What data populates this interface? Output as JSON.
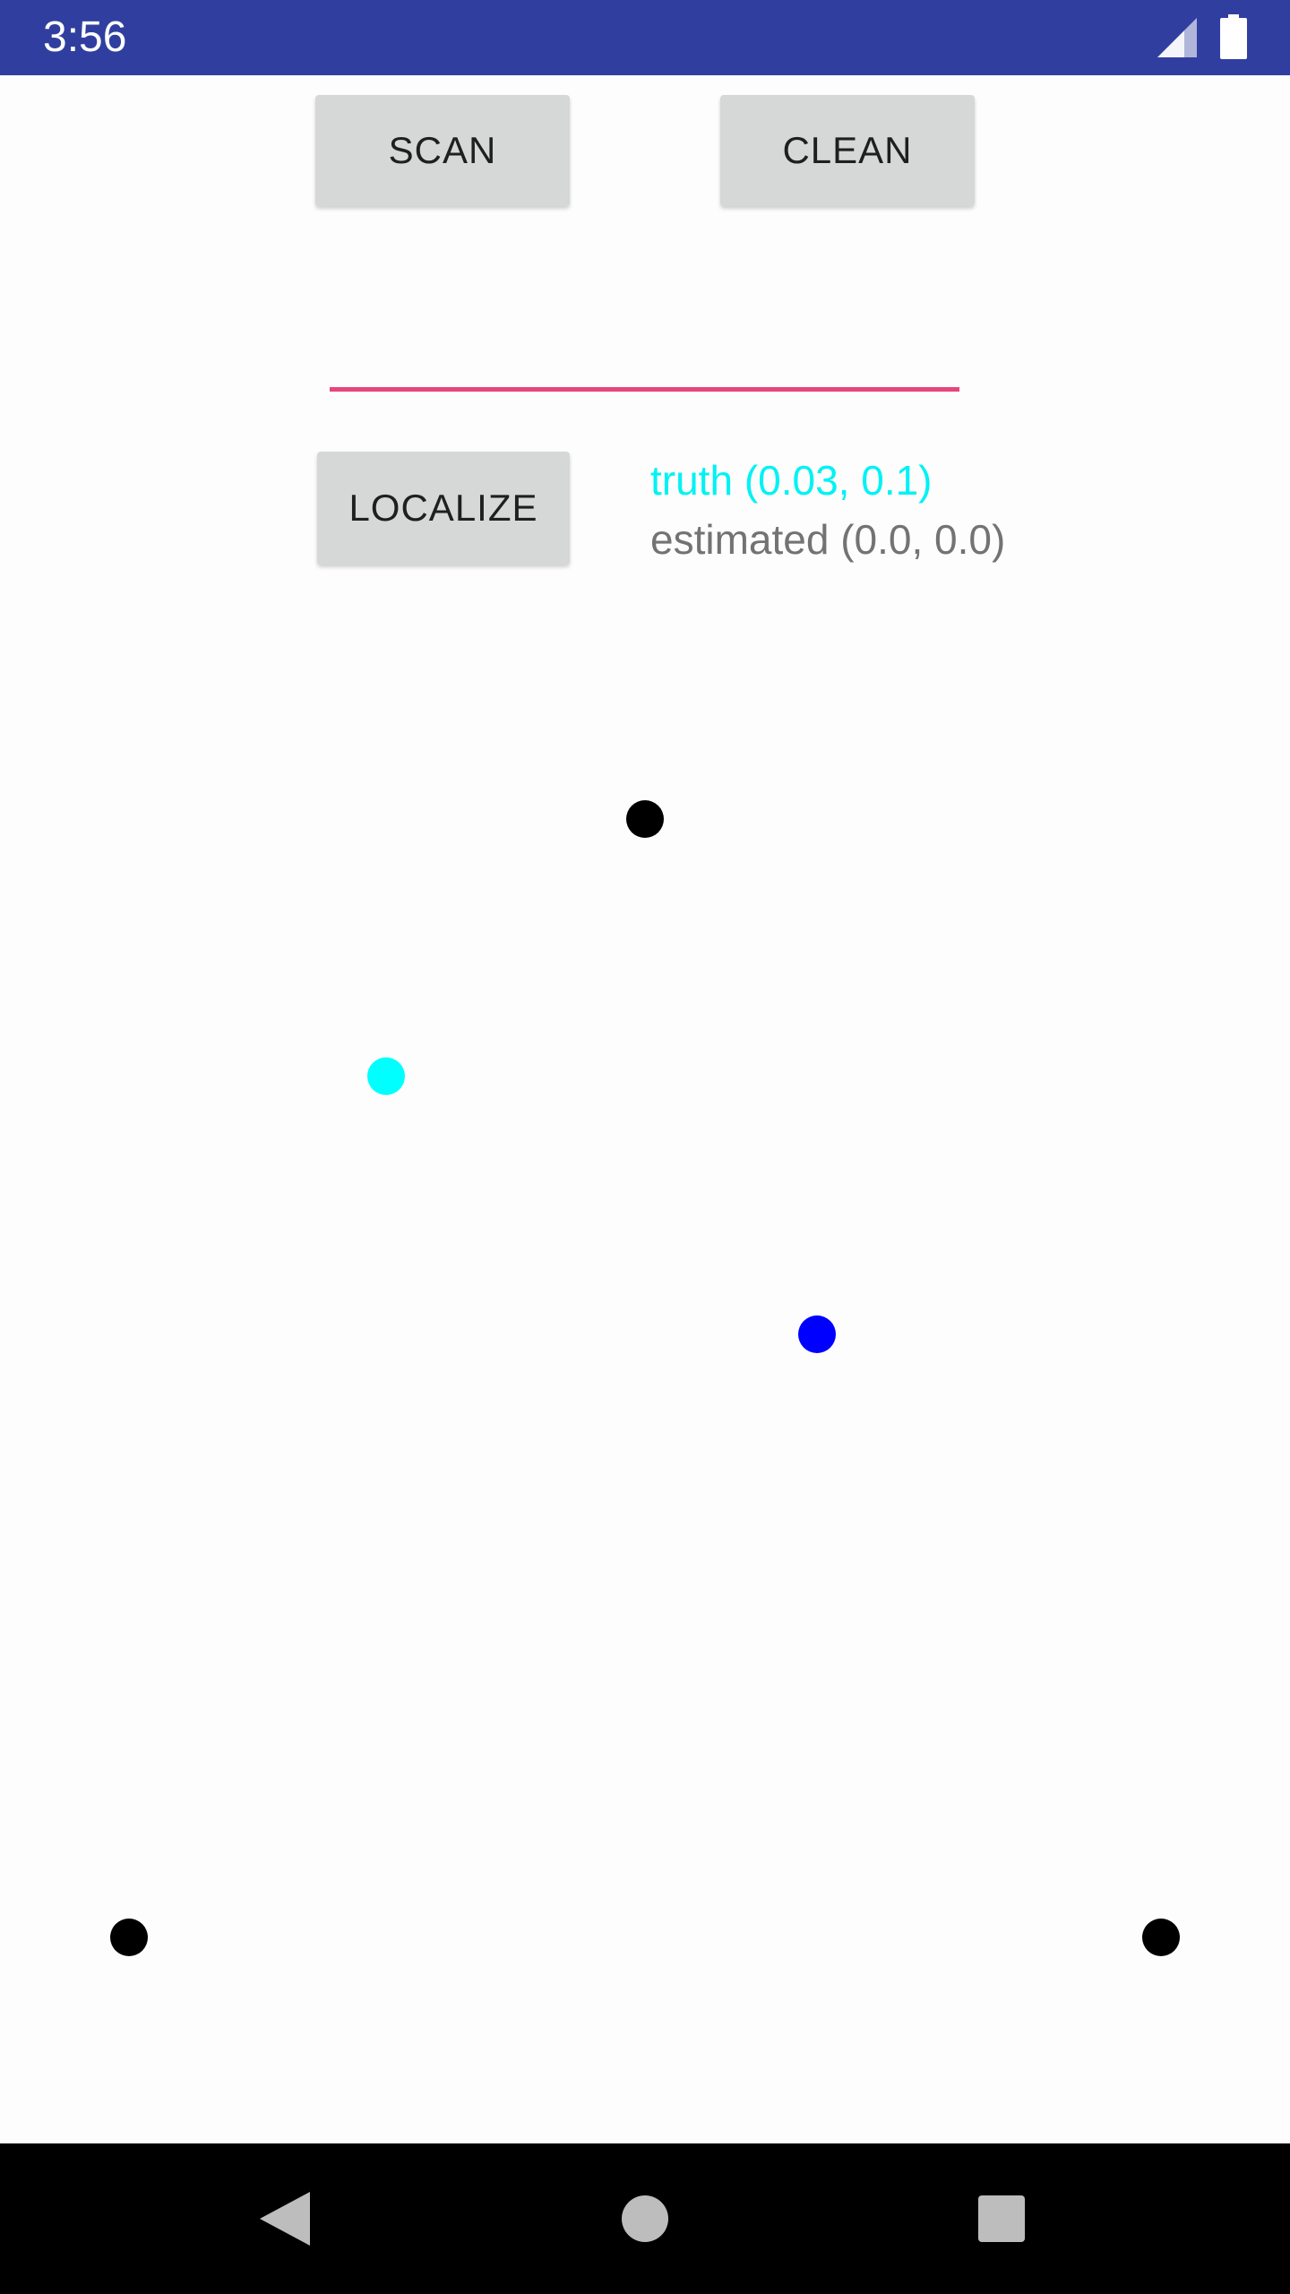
{
  "status_bar": {
    "time": "3:56",
    "background": "#303f9f",
    "icons": [
      "signal-icon",
      "battery-icon"
    ]
  },
  "toolbar": {
    "scan_label": "SCAN",
    "clean_label": "CLEAN",
    "localize_label": "LOCALIZE"
  },
  "input": {
    "value": "",
    "underline_color": "#e8457a"
  },
  "position": {
    "truth_label": "truth (0.03, 0.1)",
    "estimated_label": "estimated (0.0, 0.0)",
    "truth_color": "#00f2f4",
    "estimated_color": "#737373"
  },
  "map": {
    "anchor_color": "#000000",
    "truth_dot_color": "#00ffff",
    "estimated_dot_color": "#0000ff"
  },
  "nav_bar": {
    "icons": [
      "back-icon",
      "home-icon",
      "recents-icon"
    ]
  }
}
